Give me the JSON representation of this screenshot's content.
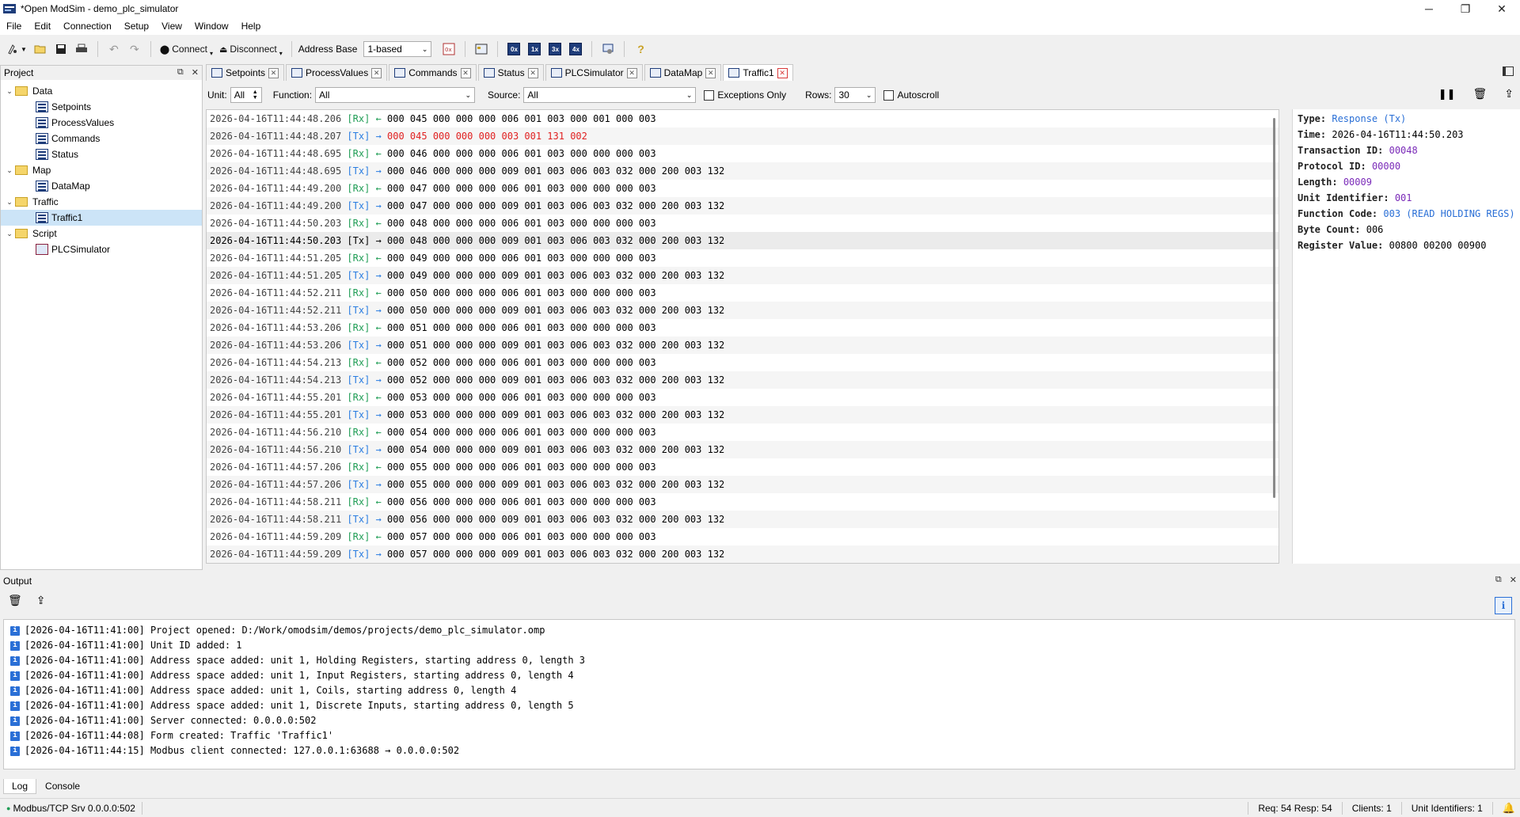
{
  "window": {
    "title": "*Open ModSim - demo_plc_simulator",
    "minimize": "─",
    "maximize": "❐",
    "close": "✕"
  },
  "menu": [
    "File",
    "Edit",
    "Connection",
    "Setup",
    "View",
    "Window",
    "Help"
  ],
  "toolbar": {
    "connect_label": "Connect",
    "disconnect_label": "Disconnect",
    "address_base_label": "Address Base",
    "address_base_value": "1-based",
    "reg_buttons": [
      "0x",
      "1x",
      "3x",
      "4x"
    ]
  },
  "project": {
    "title": "Project",
    "tree": [
      {
        "label": "Data",
        "type": "folder"
      },
      {
        "label": "Setpoints",
        "type": "form"
      },
      {
        "label": "ProcessValues",
        "type": "form"
      },
      {
        "label": "Commands",
        "type": "form"
      },
      {
        "label": "Status",
        "type": "form"
      },
      {
        "label": "Map",
        "type": "folder"
      },
      {
        "label": "DataMap",
        "type": "form"
      },
      {
        "label": "Traffic",
        "type": "folder"
      },
      {
        "label": "Traffic1",
        "type": "form"
      },
      {
        "label": "Script",
        "type": "folder"
      },
      {
        "label": "PLCSimulator",
        "type": "script"
      }
    ]
  },
  "tabs": [
    "Setpoints",
    "ProcessValues",
    "Commands",
    "Status",
    "PLCSimulator",
    "DataMap",
    "Traffic1"
  ],
  "filter": {
    "unit_label": "Unit:",
    "unit_value": "All",
    "function_label": "Function:",
    "function_value": "All",
    "source_label": "Source:",
    "source_value": "All",
    "exceptions_label": "Exceptions Only",
    "rows_label": "Rows:",
    "rows_value": "30",
    "autoscroll_label": "Autoscroll"
  },
  "traffic": [
    {
      "ts": "2026-04-16T11:44:48.206",
      "dir": "[Rx]",
      "arrow": "←",
      "data": "000 045 000 000 000 006 001 003 000 001 000 003"
    },
    {
      "ts": "2026-04-16T11:44:48.207",
      "dir": "[Tx]",
      "arrow": "→",
      "data": "000 045 000 000 000 003 001 131 002",
      "error": true
    },
    {
      "ts": "2026-04-16T11:44:48.695",
      "dir": "[Rx]",
      "arrow": "←",
      "data": "000 046 000 000 000 006 001 003 000 000 000 003"
    },
    {
      "ts": "2026-04-16T11:44:48.695",
      "dir": "[Tx]",
      "arrow": "→",
      "data": "000 046 000 000 000 009 001 003 006 003 032 000 200 003 132"
    },
    {
      "ts": "2026-04-16T11:44:49.200",
      "dir": "[Rx]",
      "arrow": "←",
      "data": "000 047 000 000 000 006 001 003 000 000 000 003"
    },
    {
      "ts": "2026-04-16T11:44:49.200",
      "dir": "[Tx]",
      "arrow": "→",
      "data": "000 047 000 000 000 009 001 003 006 003 032 000 200 003 132"
    },
    {
      "ts": "2026-04-16T11:44:50.203",
      "dir": "[Rx]",
      "arrow": "←",
      "data": "000 048 000 000 000 006 001 003 000 000 000 003"
    },
    {
      "ts": "2026-04-16T11:44:50.203",
      "dir": "[Tx]",
      "arrow": "→",
      "data": "000 048 000 000 000 009 001 003 006 003 032 000 200 003 132",
      "selected": true
    },
    {
      "ts": "2026-04-16T11:44:51.205",
      "dir": "[Rx]",
      "arrow": "←",
      "data": "000 049 000 000 000 006 001 003 000 000 000 003"
    },
    {
      "ts": "2026-04-16T11:44:51.205",
      "dir": "[Tx]",
      "arrow": "→",
      "data": "000 049 000 000 000 009 001 003 006 003 032 000 200 003 132"
    },
    {
      "ts": "2026-04-16T11:44:52.211",
      "dir": "[Rx]",
      "arrow": "←",
      "data": "000 050 000 000 000 006 001 003 000 000 000 003"
    },
    {
      "ts": "2026-04-16T11:44:52.211",
      "dir": "[Tx]",
      "arrow": "→",
      "data": "000 050 000 000 000 009 001 003 006 003 032 000 200 003 132"
    },
    {
      "ts": "2026-04-16T11:44:53.206",
      "dir": "[Rx]",
      "arrow": "←",
      "data": "000 051 000 000 000 006 001 003 000 000 000 003"
    },
    {
      "ts": "2026-04-16T11:44:53.206",
      "dir": "[Tx]",
      "arrow": "→",
      "data": "000 051 000 000 000 009 001 003 006 003 032 000 200 003 132"
    },
    {
      "ts": "2026-04-16T11:44:54.213",
      "dir": "[Rx]",
      "arrow": "←",
      "data": "000 052 000 000 000 006 001 003 000 000 000 003"
    },
    {
      "ts": "2026-04-16T11:44:54.213",
      "dir": "[Tx]",
      "arrow": "→",
      "data": "000 052 000 000 000 009 001 003 006 003 032 000 200 003 132"
    },
    {
      "ts": "2026-04-16T11:44:55.201",
      "dir": "[Rx]",
      "arrow": "←",
      "data": "000 053 000 000 000 006 001 003 000 000 000 003"
    },
    {
      "ts": "2026-04-16T11:44:55.201",
      "dir": "[Tx]",
      "arrow": "→",
      "data": "000 053 000 000 000 009 001 003 006 003 032 000 200 003 132"
    },
    {
      "ts": "2026-04-16T11:44:56.210",
      "dir": "[Rx]",
      "arrow": "←",
      "data": "000 054 000 000 000 006 001 003 000 000 000 003"
    },
    {
      "ts": "2026-04-16T11:44:56.210",
      "dir": "[Tx]",
      "arrow": "→",
      "data": "000 054 000 000 000 009 001 003 006 003 032 000 200 003 132"
    },
    {
      "ts": "2026-04-16T11:44:57.206",
      "dir": "[Rx]",
      "arrow": "←",
      "data": "000 055 000 000 000 006 001 003 000 000 000 003"
    },
    {
      "ts": "2026-04-16T11:44:57.206",
      "dir": "[Tx]",
      "arrow": "→",
      "data": "000 055 000 000 000 009 001 003 006 003 032 000 200 003 132"
    },
    {
      "ts": "2026-04-16T11:44:58.211",
      "dir": "[Rx]",
      "arrow": "←",
      "data": "000 056 000 000 000 006 001 003 000 000 000 003"
    },
    {
      "ts": "2026-04-16T11:44:58.211",
      "dir": "[Tx]",
      "arrow": "→",
      "data": "000 056 000 000 000 009 001 003 006 003 032 000 200 003 132"
    },
    {
      "ts": "2026-04-16T11:44:59.209",
      "dir": "[Rx]",
      "arrow": "←",
      "data": "000 057 000 000 000 006 001 003 000 000 000 003"
    },
    {
      "ts": "2026-04-16T11:44:59.209",
      "dir": "[Tx]",
      "arrow": "→",
      "data": "000 057 000 000 000 009 001 003 006 003 032 000 200 003 132"
    }
  ],
  "detail": [
    {
      "label": "Type:",
      "value": "Response (Tx)",
      "style": "blue"
    },
    {
      "label": "Time:",
      "value": "2026-04-16T11:44:50.203",
      "style": ""
    },
    {
      "label": "Transaction ID:",
      "value": "00048",
      "style": "purple"
    },
    {
      "label": "Protocol ID:",
      "value": "00000",
      "style": "purple"
    },
    {
      "label": "Length:",
      "value": "00009",
      "style": "purple"
    },
    {
      "label": "Unit Identifier:",
      "value": "001",
      "style": "purple"
    },
    {
      "label": "Function Code:",
      "value": "003 (READ HOLDING REGS)",
      "style": "blue"
    },
    {
      "label": "Byte Count:",
      "value": "006",
      "style": ""
    },
    {
      "label": "Register Value:",
      "value": "00800 00200 00900",
      "style": ""
    }
  ],
  "output": {
    "title": "Output",
    "lines": [
      "[2026-04-16T11:41:00] Project opened: D:/Work/omodsim/demos/projects/demo_plc_simulator.omp",
      "[2026-04-16T11:41:00] Unit ID added: 1",
      "[2026-04-16T11:41:00] Address space added: unit 1, Holding Registers, starting address 0, length 3",
      "[2026-04-16T11:41:00] Address space added: unit 1, Input Registers, starting address 0, length 4",
      "[2026-04-16T11:41:00] Address space added: unit 1, Coils, starting address 0, length 4",
      "[2026-04-16T11:41:00] Address space added: unit 1, Discrete Inputs, starting address 0, length 5",
      "[2026-04-16T11:41:00] Server connected: 0.0.0.0:502",
      "[2026-04-16T11:44:08] Form created: Traffic 'Traffic1'",
      "[2026-04-16T11:44:15] Modbus client connected: 127.0.0.1:63688 → 0.0.0.0:502"
    ],
    "info_icon": "i"
  },
  "bottom_tabs": [
    "Log",
    "Console"
  ],
  "status": {
    "server": "Modbus/TCP Srv 0.0.0.0:502",
    "req_resp": "Req: 54  Resp: 54",
    "clients": "Clients: 1",
    "unit_ids": "Unit Identifiers: 1"
  },
  "colors": {
    "rx": "#1f9d55",
    "tx": "#2a7de1",
    "error": "#e02020",
    "accent": "#2a6fd6"
  }
}
